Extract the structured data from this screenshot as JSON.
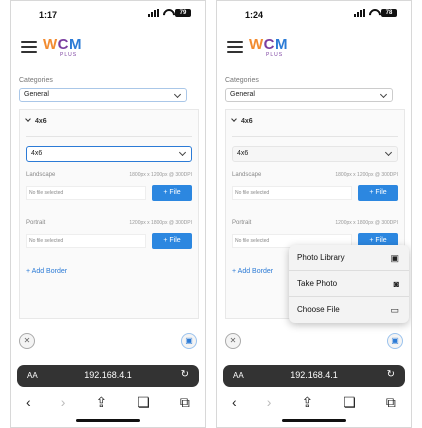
{
  "left_phone": {
    "status": {
      "time": "1:17",
      "battery": "79"
    },
    "app": {
      "logo_main": "WCM",
      "logo_sub": "PLUS"
    },
    "category": {
      "label": "Categories",
      "value": "General"
    },
    "card": {
      "title": "4x6",
      "size_value": "4x6",
      "rows": [
        {
          "name": "Landscape",
          "dims": "1800px x 1200px @ 300DPI",
          "nofile": "No file selected",
          "button": "+ File"
        },
        {
          "name": "Portrait",
          "dims": "1200px x 1800px @ 300DPI",
          "nofile": "No file selected",
          "button": "+ File"
        }
      ],
      "add_border": "+ Add Border"
    },
    "browser": {
      "aa": "AA",
      "url": "192.168.4.1"
    }
  },
  "right_phone": {
    "status": {
      "time": "1:24",
      "battery": "78"
    },
    "app": {
      "logo_main": "WCM",
      "logo_sub": "PLUS"
    },
    "category": {
      "label": "Categories",
      "value": "General"
    },
    "card": {
      "title": "4x6",
      "size_value": "4x6",
      "rows": [
        {
          "name": "Landscape",
          "dims": "1800px x 1200px @ 300DPI",
          "nofile": "No file selected",
          "button": "+ File"
        },
        {
          "name": "Portrait",
          "dims": "1200px x 1800px @ 300DPI",
          "nofile": "No file selected",
          "button": "+ File"
        }
      ],
      "add_border": "+ Add Border"
    },
    "menu": [
      {
        "label": "Photo Library",
        "icon": "photo-library-icon"
      },
      {
        "label": "Take Photo",
        "icon": "camera-icon"
      },
      {
        "label": "Choose File",
        "icon": "folder-icon"
      }
    ],
    "browser": {
      "aa": "AA",
      "url": "192.168.4.1"
    }
  }
}
